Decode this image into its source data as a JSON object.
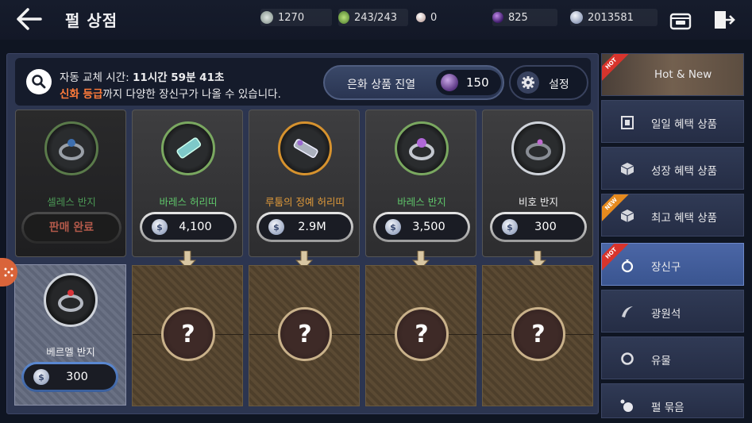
{
  "header": {
    "title": "펄 상점",
    "currencies": [
      {
        "icon": "silver-leaf-icon",
        "value": "1270"
      },
      {
        "icon": "stamina-icon",
        "value": "243/243"
      },
      {
        "icon": "pearl-icon",
        "value": "0"
      },
      {
        "icon": "purple-gem-icon",
        "value": "825"
      },
      {
        "icon": "silver-coin-icon",
        "value": "2013581"
      }
    ]
  },
  "info": {
    "refresh_label": "자동 교체 시간:",
    "refresh_time": "11시간 59분 41초",
    "grade_highlight": "신화 등급",
    "grade_rest": "까지 다양한 장신구가 나올 수 있습니다."
  },
  "upgrade": {
    "label": "은화 상품 진열",
    "count": "150"
  },
  "settings": {
    "label": "설정"
  },
  "cards": [
    {
      "name": "셀레스 반지",
      "name_color": "#5fc66a",
      "sold": true,
      "sold_label": "판매 완료",
      "ring_color": "#6aa85a",
      "gem": "#3d6fb0"
    },
    {
      "name": "바레스 허리띠",
      "name_color": "#5fc66a",
      "sold": false,
      "price": "4,100",
      "ring_color": "#7aa860",
      "gem": "#7ec9c9"
    },
    {
      "name": "루툼의 정예 허리띠",
      "name_color": "#e09a3a",
      "sold": false,
      "price": "2.9M",
      "ring_color": "#d6922e",
      "gem": "#9a6ad0"
    },
    {
      "name": "바레스 반지",
      "name_color": "#5fc66a",
      "sold": false,
      "price": "3,500",
      "ring_color": "#7aa860",
      "gem": "#b067d8"
    },
    {
      "name": "비호 반지",
      "name_color": "#efefef",
      "sold": false,
      "price": "300",
      "ring_color": "#cfd3da",
      "gem": "#c06ad0"
    }
  ],
  "owned": {
    "name": "베르멜 반지",
    "price": "300"
  },
  "mystery_slots": [
    "?",
    "?",
    "?",
    "?"
  ],
  "sidebar": [
    {
      "label": "Hot & New",
      "badge": "HOT"
    },
    {
      "label": "일일 혜택 상품",
      "badge": ""
    },
    {
      "label": "성장 혜택 상품",
      "badge": ""
    },
    {
      "label": "최고 혜택 상품",
      "badge": "NEW"
    },
    {
      "label": "장신구",
      "badge": "HOT"
    },
    {
      "label": "광원석",
      "badge": ""
    },
    {
      "label": "유물",
      "badge": ""
    },
    {
      "label": "펄 묶음",
      "badge": ""
    }
  ],
  "colors": {
    "accent": "#3a5590",
    "highlight": "#ff7b3a",
    "hot": "#d8342c",
    "new": "#e68a1e"
  }
}
